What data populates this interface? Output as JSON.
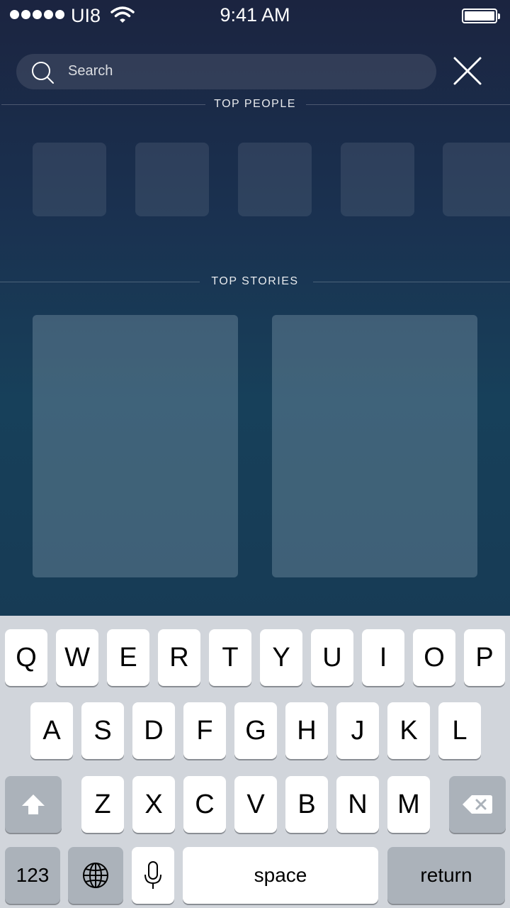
{
  "status_bar": {
    "carrier": "UI8",
    "time": "9:41 AM"
  },
  "search": {
    "placeholder": "Search"
  },
  "sections": {
    "people_title": "TOP PEOPLE",
    "stories_title": "TOP STORIES"
  },
  "keyboard": {
    "row1": [
      "Q",
      "W",
      "E",
      "R",
      "T",
      "Y",
      "U",
      "I",
      "O",
      "P"
    ],
    "row2": [
      "A",
      "S",
      "D",
      "F",
      "G",
      "H",
      "J",
      "K",
      "L"
    ],
    "row3": [
      "Z",
      "X",
      "C",
      "V",
      "B",
      "N",
      "M"
    ],
    "numbers_label": "123",
    "space_label": "space",
    "return_label": "return"
  },
  "icons": [
    "wifi-icon",
    "battery-icon",
    "search-icon",
    "close-icon",
    "shift-icon",
    "backspace-icon",
    "globe-icon",
    "microphone-icon"
  ]
}
